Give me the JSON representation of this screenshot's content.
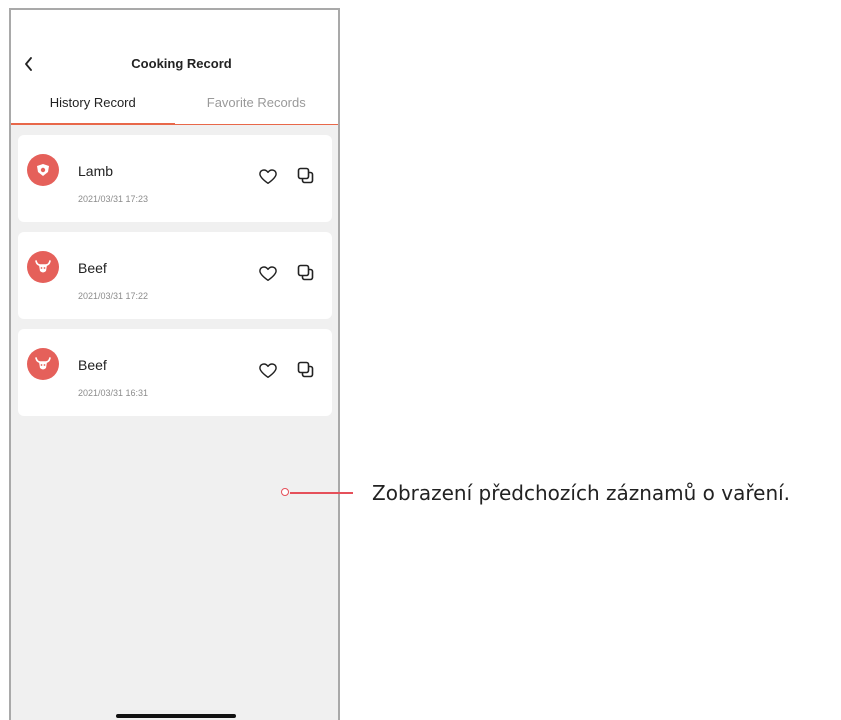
{
  "header": {
    "title": "Cooking Record"
  },
  "tabs": [
    {
      "label": "History Record",
      "active": true
    },
    {
      "label": "Favorite Records",
      "active": false
    }
  ],
  "records": [
    {
      "name": "Lamb",
      "time": "2021/03/31 17:23",
      "icon": "lamb-icon"
    },
    {
      "name": "Beef",
      "time": "2021/03/31 17:22",
      "icon": "beef-icon"
    },
    {
      "name": "Beef",
      "time": "2021/03/31 16:31",
      "icon": "beef-icon"
    }
  ],
  "annotation": {
    "text": "Zobrazení předchozích záznamů o vaření."
  },
  "colors": {
    "accent": "#e8684a",
    "avatar": "#e5605a",
    "background": "#f0f0f0"
  }
}
